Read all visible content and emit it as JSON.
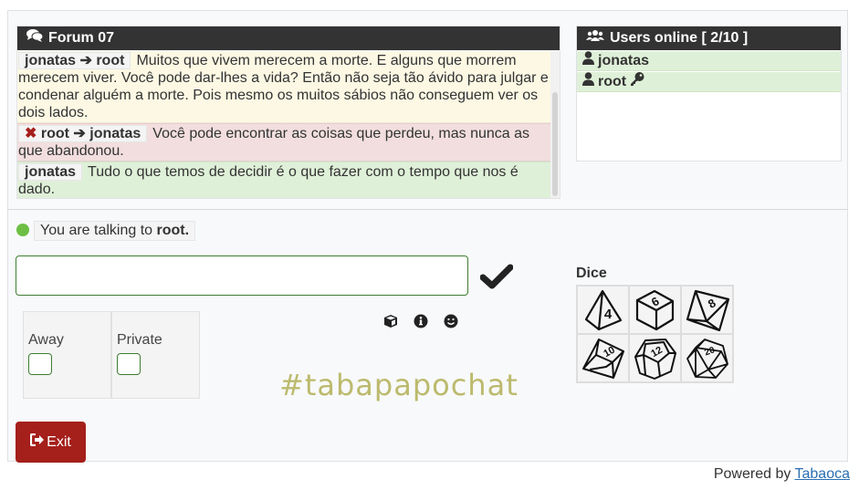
{
  "forum": {
    "title": "Forum 07",
    "icon": "comments-icon",
    "messages": [
      {
        "from": "jonatas",
        "to": "root",
        "private": false,
        "deleted": false,
        "style": "yellow",
        "text": "Muitos que vivem merecem a morte. E alguns que morrem merecem viver. Você pode dar-lhes a vida? Então não seja tão ávido para julgar e condenar alguém a morte. Pois mesmo os muitos sábios não conseguem ver os dois lados."
      },
      {
        "from": "root",
        "to": "jonatas",
        "deleted": true,
        "style": "red",
        "text": "Você pode encontrar as coisas que perdeu, mas nunca as que abandonou."
      },
      {
        "from": "jonatas",
        "to": null,
        "style": "green",
        "text": "Tudo o que temos de decidir é o que fazer com o tempo que nos é dado."
      }
    ]
  },
  "users_panel": {
    "title": "Users online [ 2/10 ]",
    "users": [
      {
        "name": "jonatas",
        "admin": false
      },
      {
        "name": "root",
        "admin": true
      }
    ]
  },
  "status": {
    "prefix": "You are talking to ",
    "target": "root.",
    "online_color": "#6cbf43"
  },
  "input": {
    "value": "",
    "placeholder": ""
  },
  "toolbar": {
    "send_icon": "check-icon",
    "tools": [
      "cube-icon",
      "info-icon",
      "smile-icon"
    ]
  },
  "options": {
    "away_label": "Away",
    "private_label": "Private",
    "away_checked": false,
    "private_checked": false
  },
  "brand": "#tabapapochat",
  "dice": {
    "title": "Dice",
    "items": [
      "4",
      "6",
      "8",
      "10",
      "12",
      "20"
    ]
  },
  "exit_label": "Exit",
  "footer": {
    "prefix": "Powered by ",
    "link": "Tabaoca"
  },
  "colors": {
    "exit": "#a51f1b",
    "brand": "#bcba6d",
    "header": "#333333"
  }
}
